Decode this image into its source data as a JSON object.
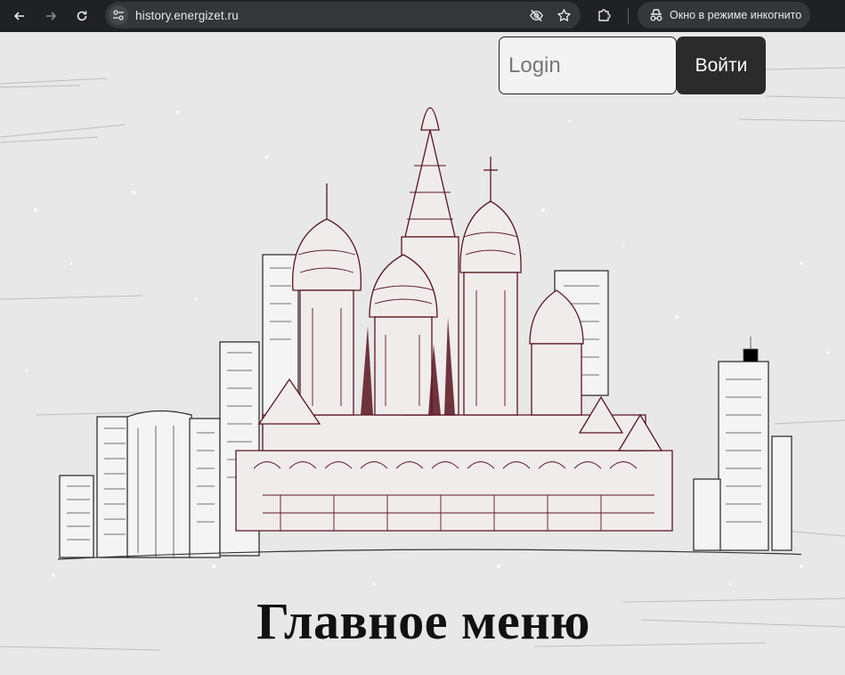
{
  "browser": {
    "url": "history.energizet.ru",
    "incognito_label": "Окно в режиме инкогнито"
  },
  "login": {
    "placeholder": "Login",
    "button_label": "Войти"
  },
  "main": {
    "title": "Главное меню"
  },
  "colors": {
    "chrome_bg": "#202124",
    "page_bg": "#e8e8e8",
    "sketch_maroon": "#5a1420",
    "button_bg": "#2b2b2b"
  }
}
